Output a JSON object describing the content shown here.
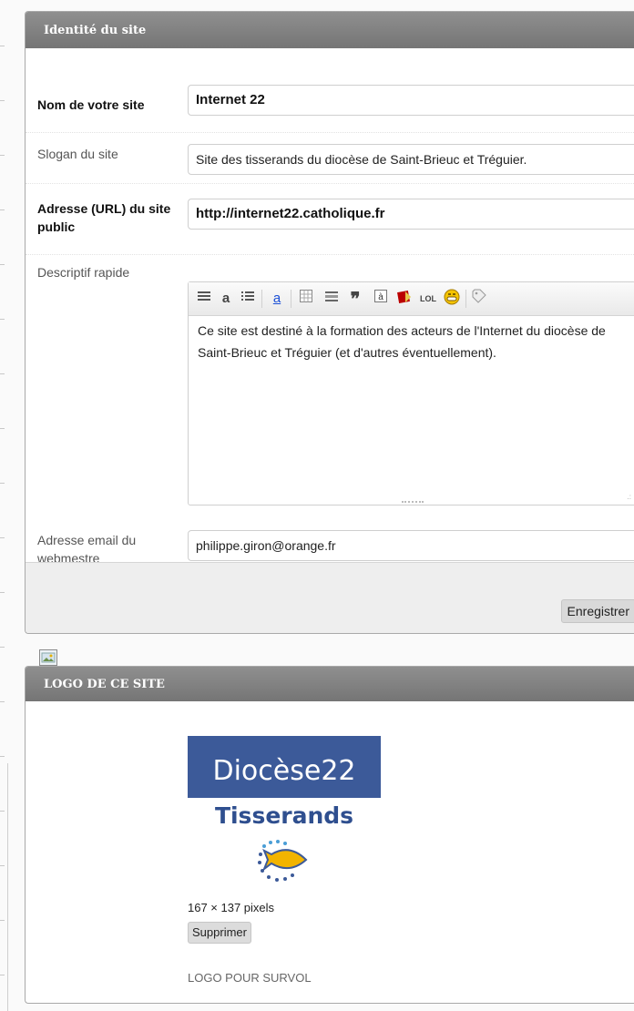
{
  "identity_panel": {
    "title": "Identité du site",
    "site_name_label": "Nom de votre site",
    "site_name_value": "Internet 22",
    "slogan_label": "Slogan du site",
    "slogan_value": "Site des tisserands du diocèse de Saint-Brieuc et Tréguier.",
    "url_label": "Adresse (URL) du site public",
    "url_value": "http://internet22.catholique.fr",
    "description_label": "Descriptif rapide",
    "description_text": "Ce site est destiné à la formation des acteurs de l'Internet du diocèse de Saint-Brieuc et Tréguier (et d'autres éventuellement).",
    "email_label": "Adresse email du webmestre",
    "email_value": "philippe.giron@orange.fr",
    "save_label": "Enregistrer"
  },
  "toolbar": {
    "icons": [
      "paragraph-icon",
      "bold-letter-icon",
      "list-icon",
      "link-letter-icon",
      "table-icon",
      "block-icon",
      "quote-icon",
      "char-icon",
      "stop-icon",
      "lol-icon",
      "smiley-icon",
      "tag-icon"
    ]
  },
  "logo_panel": {
    "title": "LOGO DE CE SITE",
    "logo_line1": "Diocèse22",
    "logo_line2": "Tisserands",
    "dimensions": "167 × 137 pixels",
    "delete_label": "Supprimer",
    "hover_logo_label": "LOGO POUR SURVOL"
  },
  "colors": {
    "header_gray": "#7f7f7f",
    "logo_blue": "#3c5a99",
    "logo_text_blue": "#2f4f8f",
    "fish_yellow": "#f2b400"
  }
}
